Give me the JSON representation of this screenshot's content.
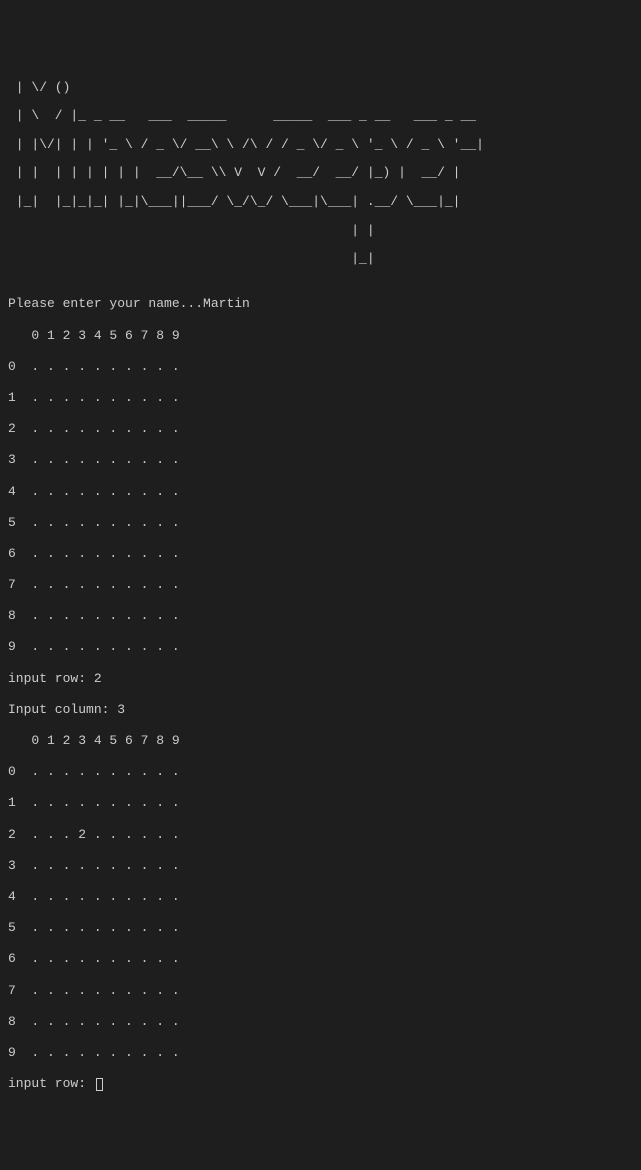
{
  "ascii_art": {
    "line1": " | \\/ ()",
    "line2": " | \\  / |_ _ __   ___  _____      _____  ___ _ __   ___ _ __",
    "line3": " | |\\/| | | '_ \\ / _ \\/ __\\ \\ /\\ / / _ \\/ _ \\ '_ \\ / _ \\ '__|",
    "line4": " | |  | | | | | |  __/\\__ \\\\ V  V /  __/  __/ |_) |  __/ |",
    "line5": " |_|  |_|_|_| |_|\\___||___/ \\_/\\_/ \\___|\\___| .__/ \\___|_|",
    "line6": "                                            | |",
    "line7": "                                            |_|"
  },
  "prompts": {
    "name_prompt": "Please enter your name...",
    "name_value": "Martin",
    "row_prompt": "input row: ",
    "row_value": "2",
    "col_prompt": "Input column: ",
    "col_value": "3",
    "row_prompt2": "input row: "
  },
  "board1": {
    "header": "   0 1 2 3 4 5 6 7 8 9",
    "rows": [
      "0  . . . . . . . . . .",
      "1  . . . . . . . . . .",
      "2  . . . . . . . . . .",
      "3  . . . . . . . . . .",
      "4  . . . . . . . . . .",
      "5  . . . . . . . . . .",
      "6  . . . . . . . . . .",
      "7  . . . . . . . . . .",
      "8  . . . . . . . . . .",
      "9  . . . . . . . . . ."
    ]
  },
  "board2": {
    "header": "   0 1 2 3 4 5 6 7 8 9",
    "rows": [
      "0  . . . . . . . . . .",
      "1  . . . . . . . . . .",
      "2  . . . 2 . . . . . .",
      "3  . . . . . . . . . .",
      "4  . . . . . . . . . .",
      "5  . . . . . . . . . .",
      "6  . . . . . . . . . .",
      "7  . . . . . . . . . .",
      "8  . . . . . . . . . .",
      "9  . . . . . . . . . ."
    ]
  }
}
